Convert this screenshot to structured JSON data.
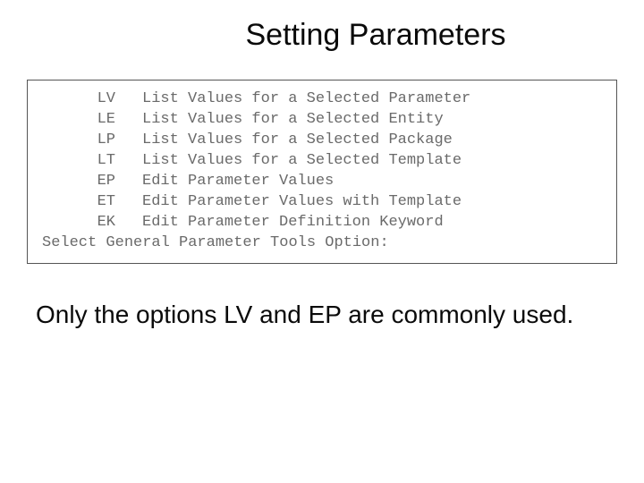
{
  "title": "Setting Parameters",
  "menu": {
    "items": [
      {
        "code": "LV",
        "desc": "List Values for a Selected Parameter"
      },
      {
        "code": "LE",
        "desc": "List Values for a Selected Entity"
      },
      {
        "code": "LP",
        "desc": "List Values for a Selected Package"
      },
      {
        "code": "LT",
        "desc": "List Values for a Selected Template"
      },
      {
        "code": "EP",
        "desc": "Edit Parameter Values"
      },
      {
        "code": "ET",
        "desc": "Edit Parameter Values with Template"
      },
      {
        "code": "EK",
        "desc": "Edit Parameter Definition Keyword"
      }
    ],
    "prompt": "Select General Parameter Tools Option:"
  },
  "body_text": "Only the options LV and EP are commonly used."
}
